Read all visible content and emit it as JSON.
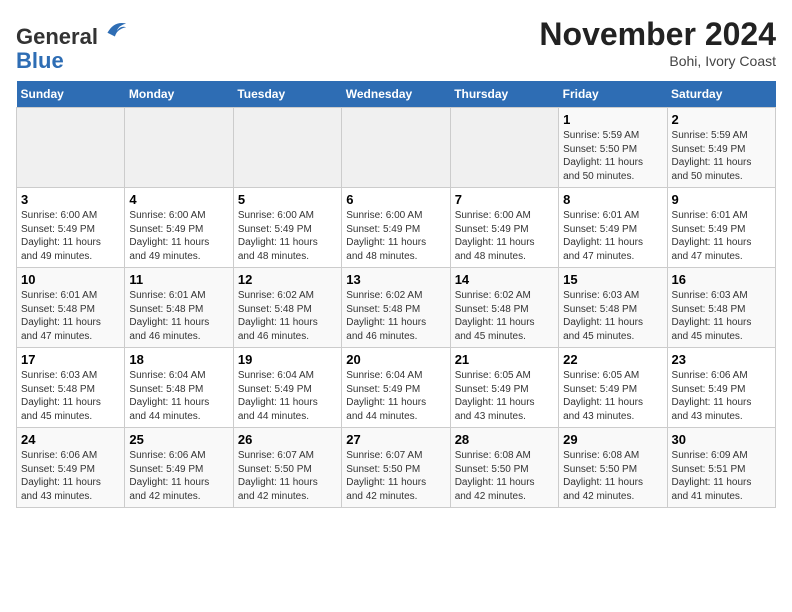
{
  "header": {
    "logo_line1": "General",
    "logo_line2": "Blue",
    "month_title": "November 2024",
    "location": "Bohi, Ivory Coast"
  },
  "weekdays": [
    "Sunday",
    "Monday",
    "Tuesday",
    "Wednesday",
    "Thursday",
    "Friday",
    "Saturday"
  ],
  "weeks": [
    [
      {
        "day": "",
        "info": ""
      },
      {
        "day": "",
        "info": ""
      },
      {
        "day": "",
        "info": ""
      },
      {
        "day": "",
        "info": ""
      },
      {
        "day": "",
        "info": ""
      },
      {
        "day": "1",
        "info": "Sunrise: 5:59 AM\nSunset: 5:50 PM\nDaylight: 11 hours\nand 50 minutes."
      },
      {
        "day": "2",
        "info": "Sunrise: 5:59 AM\nSunset: 5:49 PM\nDaylight: 11 hours\nand 50 minutes."
      }
    ],
    [
      {
        "day": "3",
        "info": "Sunrise: 6:00 AM\nSunset: 5:49 PM\nDaylight: 11 hours\nand 49 minutes."
      },
      {
        "day": "4",
        "info": "Sunrise: 6:00 AM\nSunset: 5:49 PM\nDaylight: 11 hours\nand 49 minutes."
      },
      {
        "day": "5",
        "info": "Sunrise: 6:00 AM\nSunset: 5:49 PM\nDaylight: 11 hours\nand 48 minutes."
      },
      {
        "day": "6",
        "info": "Sunrise: 6:00 AM\nSunset: 5:49 PM\nDaylight: 11 hours\nand 48 minutes."
      },
      {
        "day": "7",
        "info": "Sunrise: 6:00 AM\nSunset: 5:49 PM\nDaylight: 11 hours\nand 48 minutes."
      },
      {
        "day": "8",
        "info": "Sunrise: 6:01 AM\nSunset: 5:49 PM\nDaylight: 11 hours\nand 47 minutes."
      },
      {
        "day": "9",
        "info": "Sunrise: 6:01 AM\nSunset: 5:49 PM\nDaylight: 11 hours\nand 47 minutes."
      }
    ],
    [
      {
        "day": "10",
        "info": "Sunrise: 6:01 AM\nSunset: 5:48 PM\nDaylight: 11 hours\nand 47 minutes."
      },
      {
        "day": "11",
        "info": "Sunrise: 6:01 AM\nSunset: 5:48 PM\nDaylight: 11 hours\nand 46 minutes."
      },
      {
        "day": "12",
        "info": "Sunrise: 6:02 AM\nSunset: 5:48 PM\nDaylight: 11 hours\nand 46 minutes."
      },
      {
        "day": "13",
        "info": "Sunrise: 6:02 AM\nSunset: 5:48 PM\nDaylight: 11 hours\nand 46 minutes."
      },
      {
        "day": "14",
        "info": "Sunrise: 6:02 AM\nSunset: 5:48 PM\nDaylight: 11 hours\nand 45 minutes."
      },
      {
        "day": "15",
        "info": "Sunrise: 6:03 AM\nSunset: 5:48 PM\nDaylight: 11 hours\nand 45 minutes."
      },
      {
        "day": "16",
        "info": "Sunrise: 6:03 AM\nSunset: 5:48 PM\nDaylight: 11 hours\nand 45 minutes."
      }
    ],
    [
      {
        "day": "17",
        "info": "Sunrise: 6:03 AM\nSunset: 5:48 PM\nDaylight: 11 hours\nand 45 minutes."
      },
      {
        "day": "18",
        "info": "Sunrise: 6:04 AM\nSunset: 5:48 PM\nDaylight: 11 hours\nand 44 minutes."
      },
      {
        "day": "19",
        "info": "Sunrise: 6:04 AM\nSunset: 5:49 PM\nDaylight: 11 hours\nand 44 minutes."
      },
      {
        "day": "20",
        "info": "Sunrise: 6:04 AM\nSunset: 5:49 PM\nDaylight: 11 hours\nand 44 minutes."
      },
      {
        "day": "21",
        "info": "Sunrise: 6:05 AM\nSunset: 5:49 PM\nDaylight: 11 hours\nand 43 minutes."
      },
      {
        "day": "22",
        "info": "Sunrise: 6:05 AM\nSunset: 5:49 PM\nDaylight: 11 hours\nand 43 minutes."
      },
      {
        "day": "23",
        "info": "Sunrise: 6:06 AM\nSunset: 5:49 PM\nDaylight: 11 hours\nand 43 minutes."
      }
    ],
    [
      {
        "day": "24",
        "info": "Sunrise: 6:06 AM\nSunset: 5:49 PM\nDaylight: 11 hours\nand 43 minutes."
      },
      {
        "day": "25",
        "info": "Sunrise: 6:06 AM\nSunset: 5:49 PM\nDaylight: 11 hours\nand 42 minutes."
      },
      {
        "day": "26",
        "info": "Sunrise: 6:07 AM\nSunset: 5:50 PM\nDaylight: 11 hours\nand 42 minutes."
      },
      {
        "day": "27",
        "info": "Sunrise: 6:07 AM\nSunset: 5:50 PM\nDaylight: 11 hours\nand 42 minutes."
      },
      {
        "day": "28",
        "info": "Sunrise: 6:08 AM\nSunset: 5:50 PM\nDaylight: 11 hours\nand 42 minutes."
      },
      {
        "day": "29",
        "info": "Sunrise: 6:08 AM\nSunset: 5:50 PM\nDaylight: 11 hours\nand 42 minutes."
      },
      {
        "day": "30",
        "info": "Sunrise: 6:09 AM\nSunset: 5:51 PM\nDaylight: 11 hours\nand 41 minutes."
      }
    ]
  ]
}
